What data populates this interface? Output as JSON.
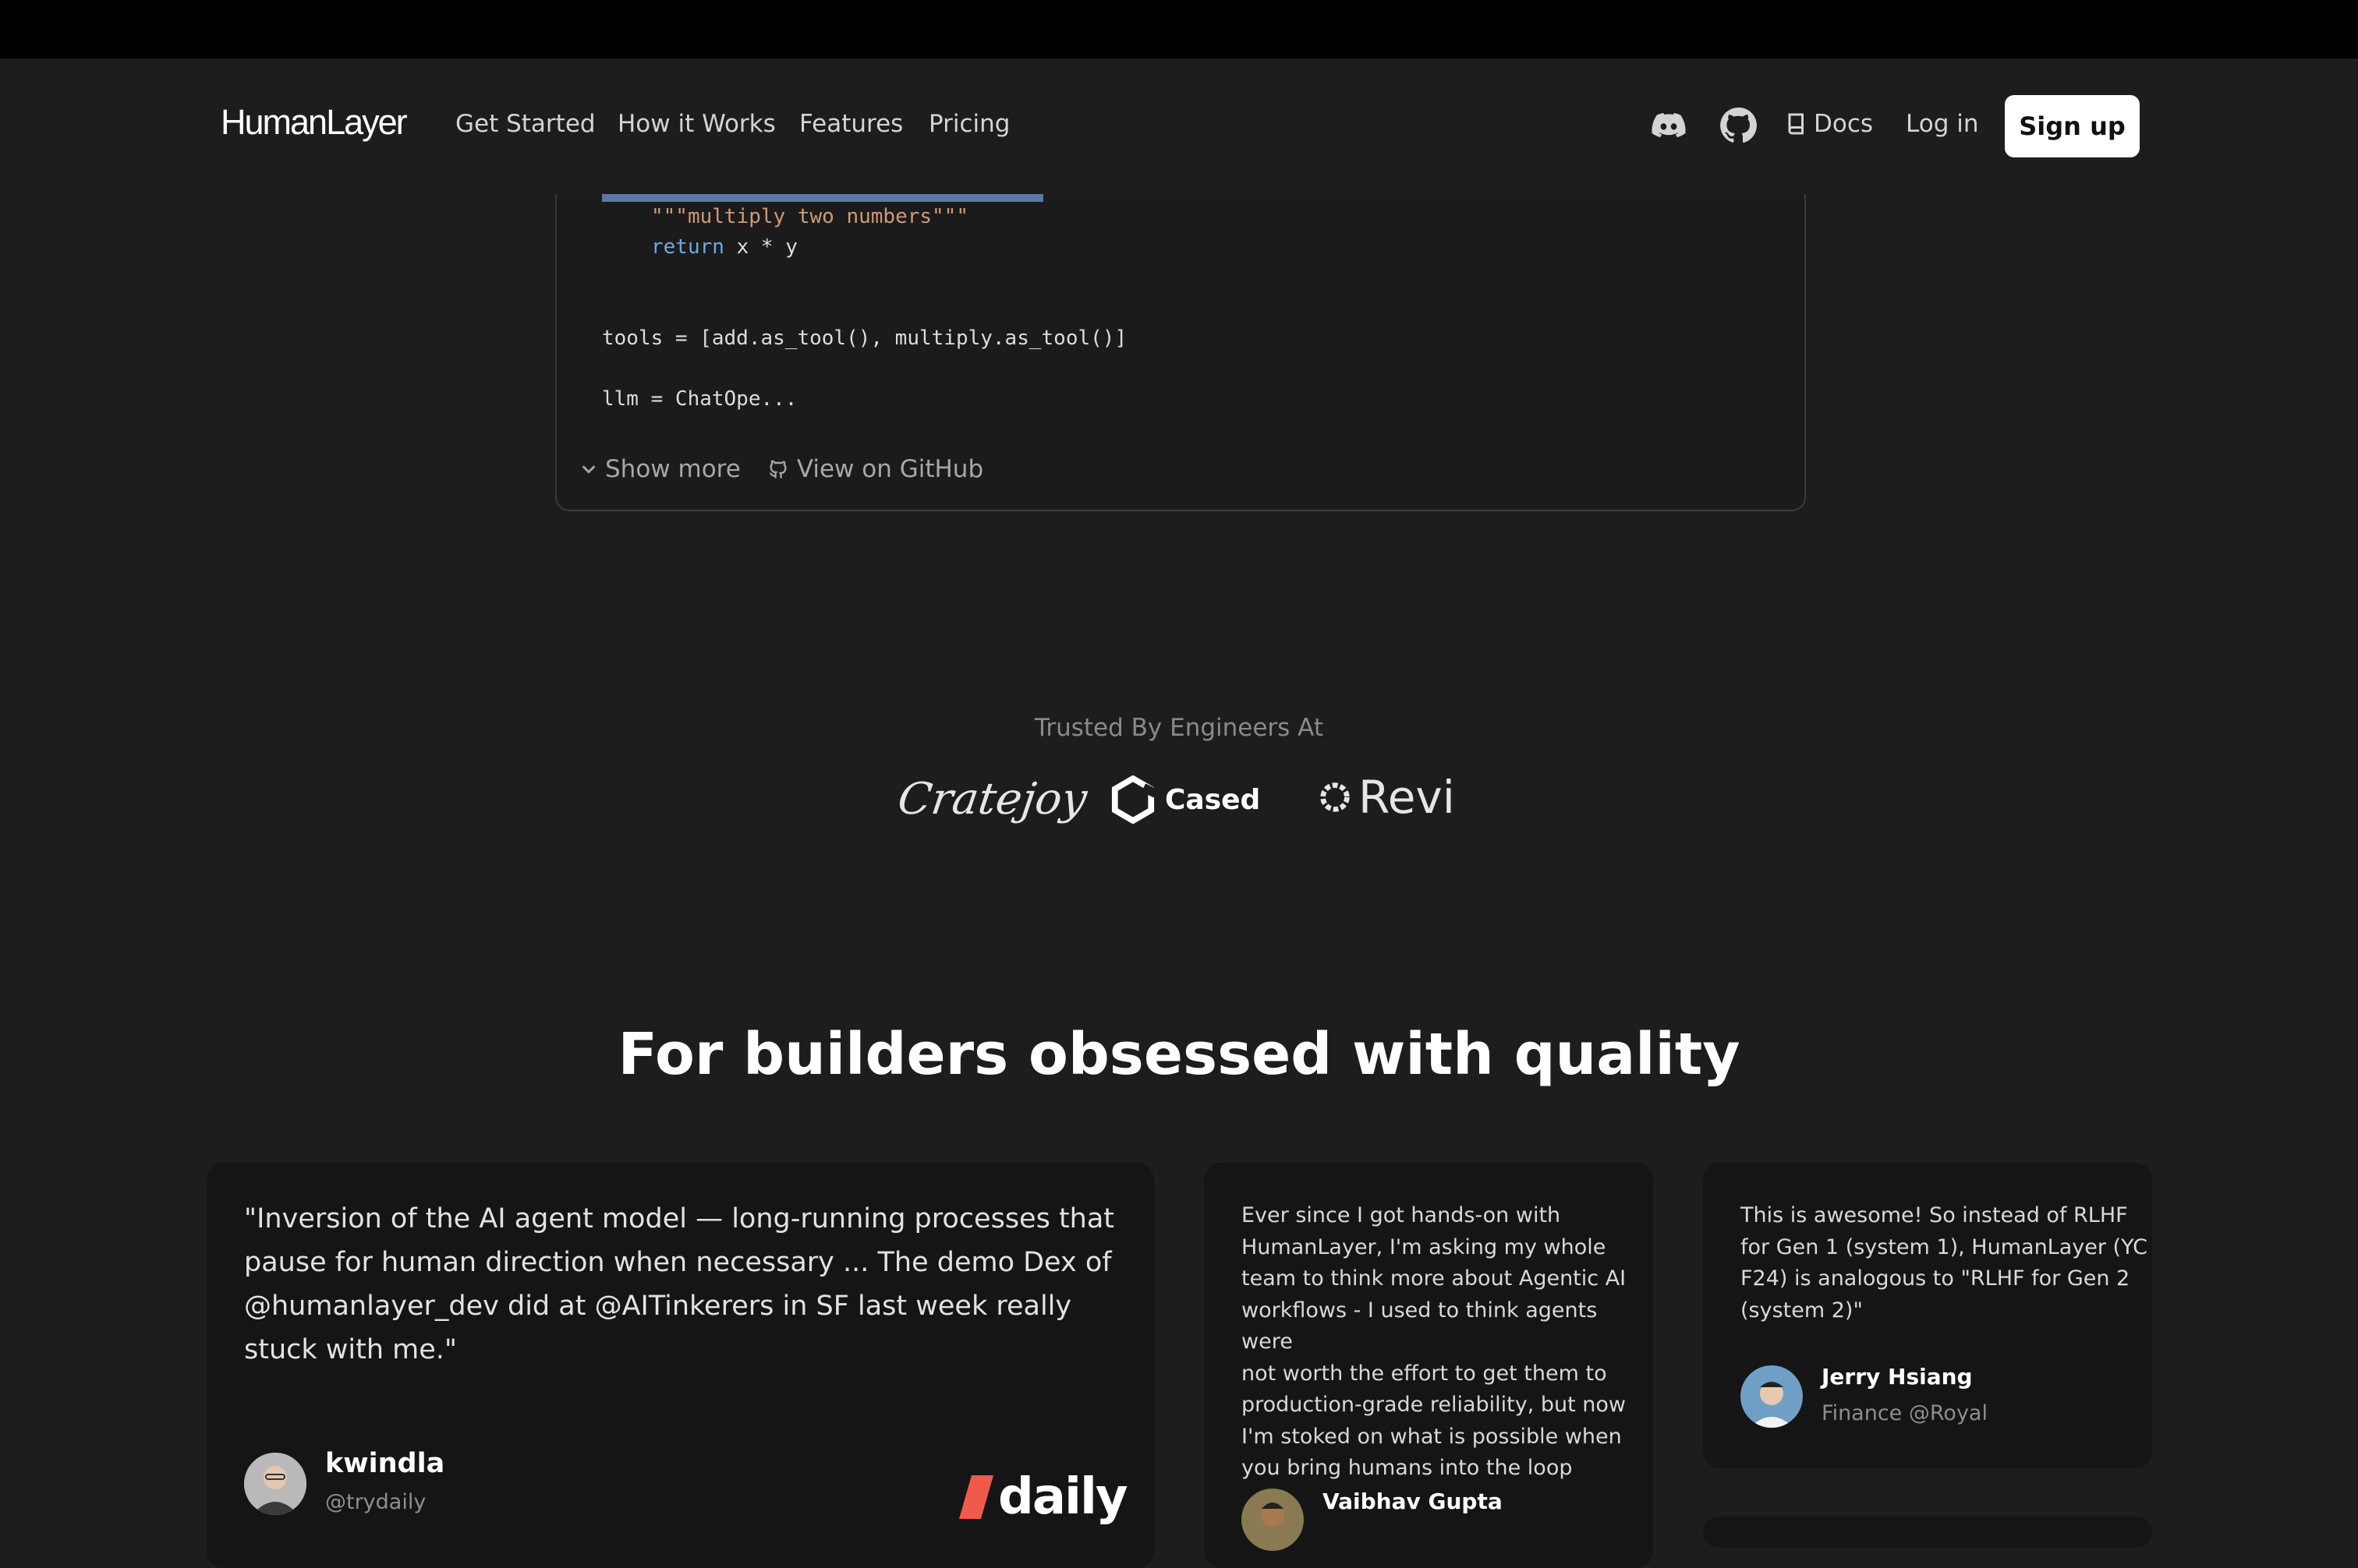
{
  "nav": {
    "logo": "HumanLayer",
    "links": [
      "Get Started",
      "How it Works",
      "Features",
      "Pricing"
    ],
    "icons": [
      "discord-icon",
      "github-icon"
    ],
    "docs": "Docs",
    "login": "Log in",
    "signup": "Sign up"
  },
  "code": {
    "line1": "\"\"\"multiply two numbers\"\"\"",
    "line2_kw": "return",
    "line2_rest": " x * y",
    "line3": "tools = [add.as_tool(), multiply.as_tool()]",
    "line4": "llm = ChatOpe...",
    "show_more": "Show more",
    "view_github": "View on GitHub"
  },
  "trusted": {
    "title": "Trusted By Engineers At",
    "logos": [
      "Cratejoy",
      "Cased",
      "Revi"
    ]
  },
  "section_title": "For builders obsessed with quality",
  "testimonials": [
    {
      "quote": "\"Inversion of the AI agent model — long-running processes that pause for human direction when necessary ... The demo Dex of @humanlayer_dev did at @AITinkerers in SF last week really stuck with me.\"",
      "name": "kwindla",
      "handle": "@trydaily",
      "company_logo": "daily"
    },
    {
      "quote_lines": [
        "Ever since I got hands-on with",
        "HumanLayer, I'm asking my whole",
        "team to think more about Agentic AI",
        "workflows - I used to think agents were",
        "not worth the effort to get them to",
        "production-grade reliability, but now",
        "I'm stoked on what is possible when",
        "you bring humans into the loop"
      ],
      "name": "Vaibhav Gupta"
    },
    {
      "quote_lines": [
        "This is awesome! So instead of RLHF",
        "for Gen 1 (system 1), HumanLayer (YC",
        "F24) is analogous to \"RLHF for Gen 2",
        "(system 2)\""
      ],
      "name": "Jerry Hsiang",
      "handle": "Finance @Royal"
    }
  ],
  "colors": {
    "background": "#1d1d1e",
    "card": "#151516",
    "code_string": "#cf9a76",
    "code_keyword": "#6ea8dc",
    "highlight": "#5b78a6"
  }
}
